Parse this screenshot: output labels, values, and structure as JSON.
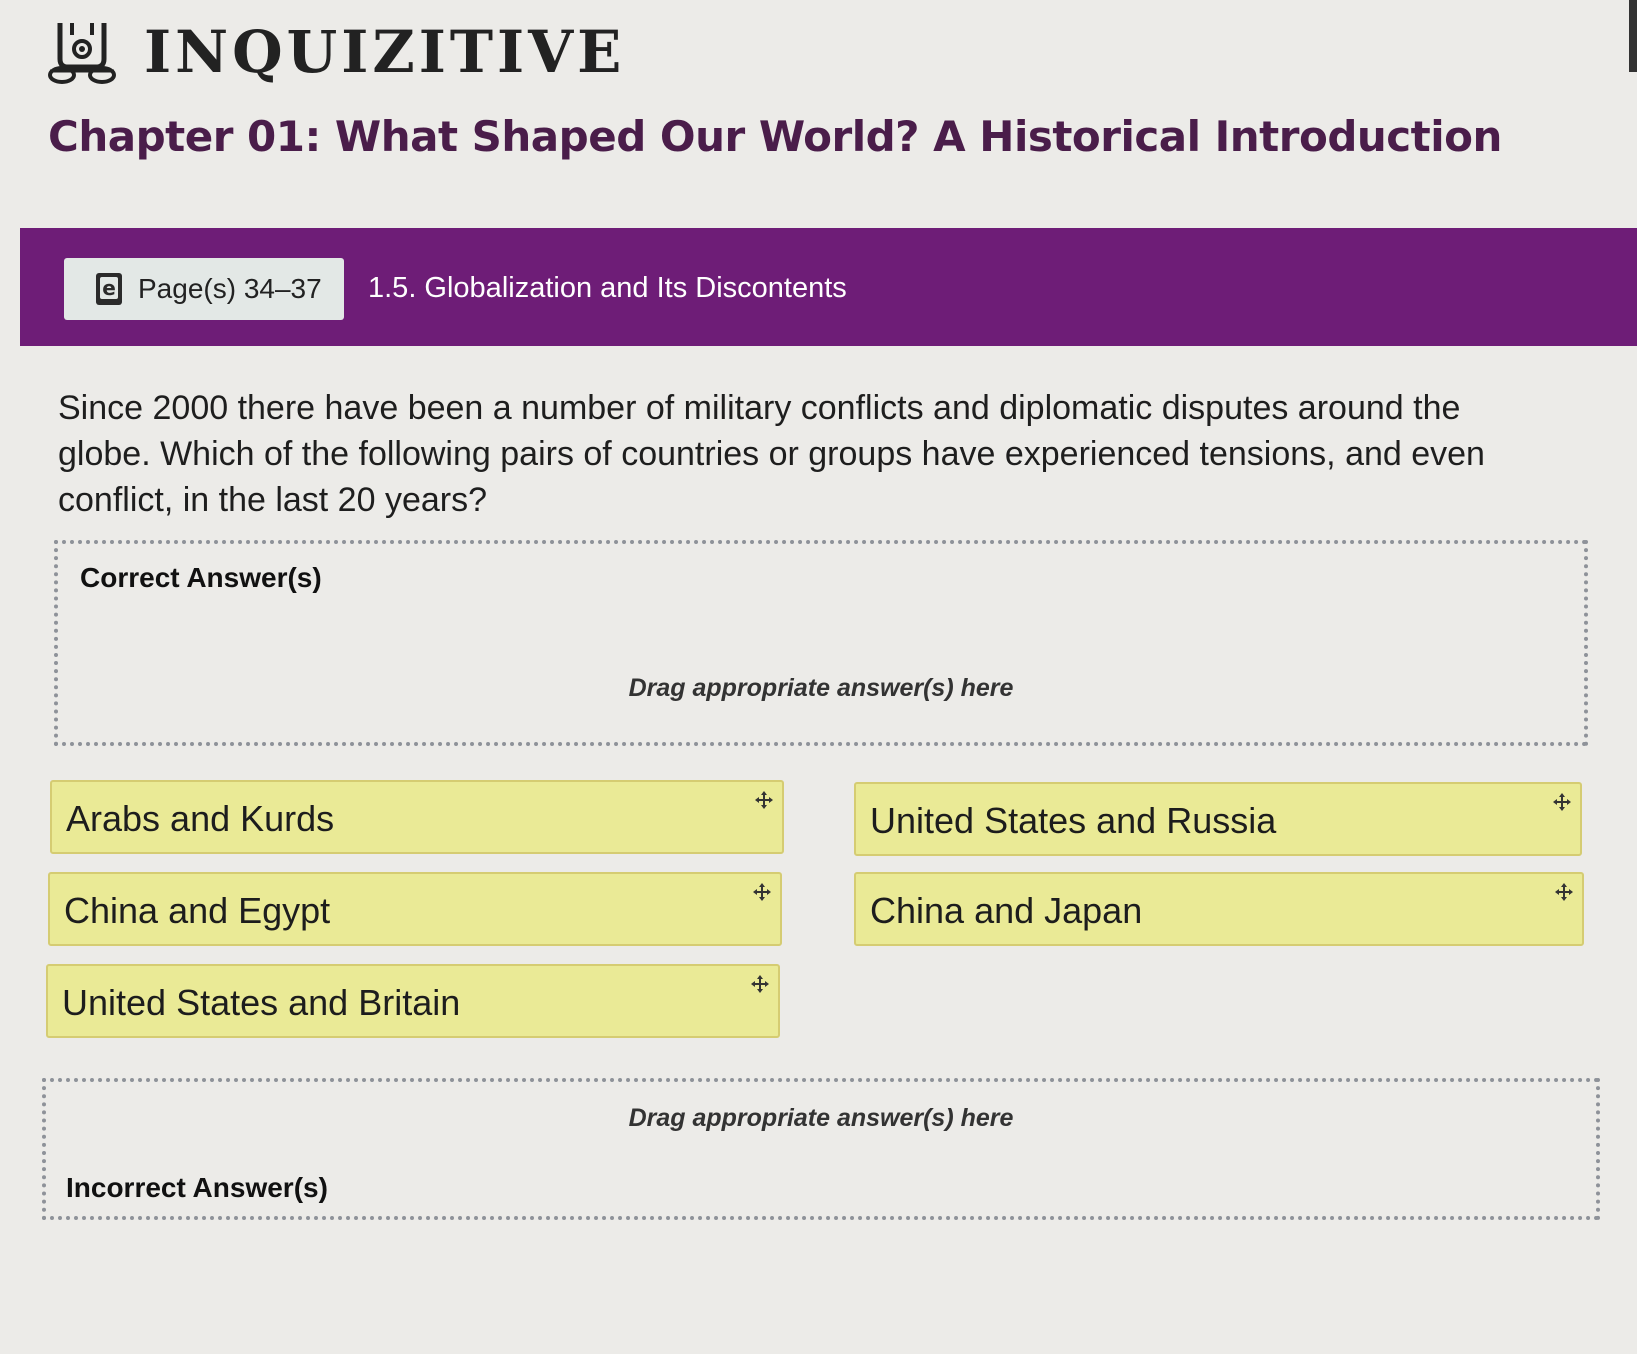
{
  "app": {
    "brand": "INQUIZITIVE",
    "chapter_title": "Chapter 01: What Shaped Our World? A Historical Introduction"
  },
  "section_bar": {
    "pages_label": "Page(s) 34–37",
    "ebook_icon": "ebook-icon",
    "section_title": "1.5. Globalization and Its Discontents"
  },
  "question": {
    "text": "Since 2000 there have been a number of military conflicts and diplomatic disputes around the globe. Which of the following pairs of countries or groups have experienced tensions, and even conflict, in the last 20 years?"
  },
  "dropzones": {
    "correct": {
      "label": "Correct Answer(s)",
      "hint": "Drag appropriate answer(s) here"
    },
    "incorrect": {
      "label": "Incorrect Answer(s)",
      "hint": "Drag appropriate answer(s) here"
    }
  },
  "answers": [
    {
      "label": "Arabs and Kurds",
      "icon": "move-icon"
    },
    {
      "label": "United States and Russia",
      "icon": "move-icon"
    },
    {
      "label": "China and Egypt",
      "icon": "move-icon"
    },
    {
      "label": "China and Japan",
      "icon": "move-icon"
    },
    {
      "label": "United States and Britain",
      "icon": "move-icon"
    }
  ],
  "colors": {
    "section_bar": "#6e1d77",
    "chapter_title": "#4a1d4a",
    "answer_card": "#eaea96",
    "background": "#ecebe8"
  }
}
